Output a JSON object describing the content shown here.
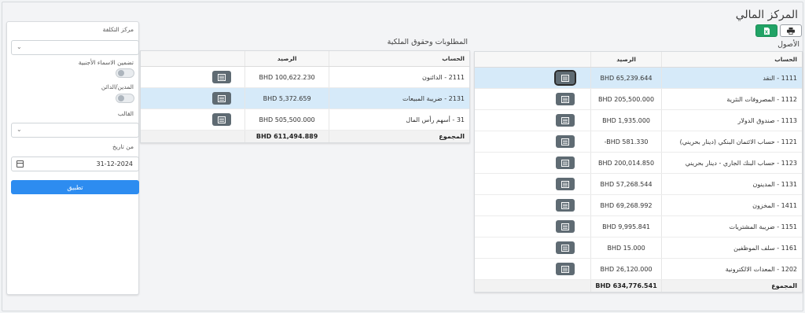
{
  "page": {
    "title": "المركز المالي",
    "print_icon": "printer-icon",
    "excel_icon": "excel-file-icon",
    "colors": {
      "accent": "#2d8cf0",
      "excel": "#21a366",
      "selected_row": "#d6eaf9",
      "view_button": "#5f6b73"
    }
  },
  "assets": {
    "title": "الأصول",
    "col_account": "الحساب",
    "col_balance": "الرصيد",
    "rows": [
      {
        "account": "1111 - النقد",
        "balance": "BHD 65,239.644"
      },
      {
        "account": "1112 - المصروفات النثرية",
        "balance": "BHD 205,500.000"
      },
      {
        "account": "1113 - صندوق الدولار",
        "balance": "BHD 1,935.000"
      },
      {
        "account": "1121 - حساب الائتمان البنكي (دينار بحريني)",
        "balance": "-BHD 581.330"
      },
      {
        "account": "1123 - حساب البنك الجاري - دينار بحريني",
        "balance": "BHD 200,014.850"
      },
      {
        "account": "1131 - المدينون",
        "balance": "BHD 57,268.544"
      },
      {
        "account": "1411 - المخزون",
        "balance": "BHD 69,268.992"
      },
      {
        "account": "1151 - ضريبة المشتريات",
        "balance": "BHD 9,995.841"
      },
      {
        "account": "1161 - سلف الموظفين",
        "balance": "BHD 15.000"
      },
      {
        "account": "1202 - المعدات الالكترونية",
        "balance": "BHD 26,120.000"
      }
    ],
    "total_label": "المجموع",
    "total": "BHD 634,776.541"
  },
  "liabilities": {
    "title": "المطلوبات وحقوق الملكية",
    "col_account": "الحساب",
    "col_balance": "الرصيد",
    "rows": [
      {
        "account": "2111 - الدائنون",
        "balance": "BHD 100,622.230"
      },
      {
        "account": "2131 - ضريبة المبيعات",
        "balance": "BHD 5,372.659"
      },
      {
        "account": "31 - أسهم رأس المال",
        "balance": "BHD 505,500.000"
      }
    ],
    "total_label": "المجموع",
    "total": "BHD 611,494.889"
  },
  "filters": {
    "cost_center_label": "مركز التكلفة",
    "cost_center_value": "",
    "foreign_names_label": "تضمين الاسماء الأجنبية",
    "debit_credit_label": "المدين/الدائن",
    "template_label": "القالب",
    "template_value": "",
    "from_date_label": "من تاريخ",
    "from_date_value": "31-12-2024",
    "apply_label": "تطبيق"
  }
}
